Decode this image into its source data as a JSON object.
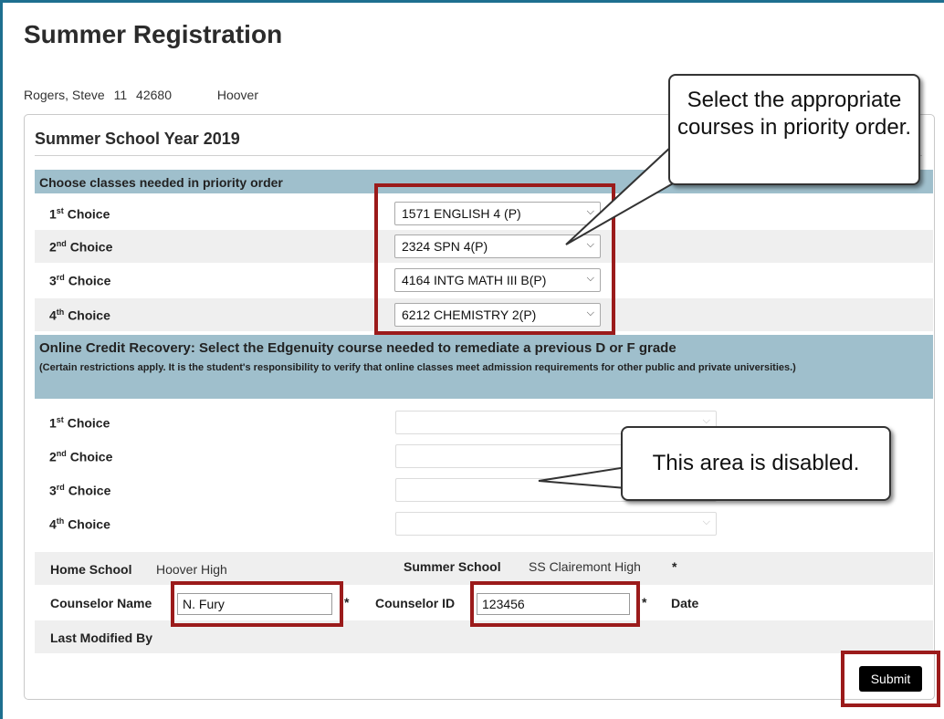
{
  "page": {
    "title": "Summer Registration"
  },
  "student": {
    "name": "Rogers, Steve",
    "grade": "11",
    "id": "42680",
    "school": "Hoover"
  },
  "panel": {
    "title": "Summer School Year 2019"
  },
  "classes": {
    "header": "Choose classes needed in priority order",
    "choices": [
      {
        "ord": "1",
        "suffix": "st",
        "label": "Choice",
        "value": "1571 ENGLISH 4 (P)"
      },
      {
        "ord": "2",
        "suffix": "nd",
        "label": "Choice",
        "value": "2324 SPN 4(P)"
      },
      {
        "ord": "3",
        "suffix": "rd",
        "label": "Choice",
        "value": "4164 INTG MATH III B(P)"
      },
      {
        "ord": "4",
        "suffix": "th",
        "label": "Choice",
        "value": "6212 CHEMISTRY 2(P)"
      }
    ]
  },
  "online": {
    "header": "Online Credit Recovery: Select the Edgenuity course needed to remediate a previous D or F grade",
    "note": "(Certain restrictions apply. It is the student's responsibility to verify that online classes meet admission requirements for other public and private universities.)",
    "choices": [
      {
        "ord": "1",
        "suffix": "st",
        "label": "Choice",
        "value": ""
      },
      {
        "ord": "2",
        "suffix": "nd",
        "label": "Choice",
        "value": ""
      },
      {
        "ord": "3",
        "suffix": "rd",
        "label": "Choice",
        "value": ""
      },
      {
        "ord": "4",
        "suffix": "th",
        "label": "Choice",
        "value": ""
      }
    ]
  },
  "footer": {
    "home_school_label": "Home School",
    "home_school_value": "Hoover High",
    "summer_school_label": "Summer School",
    "summer_school_value": "SS Clairemont High",
    "required_mark": "*",
    "counselor_name_label": "Counselor Name",
    "counselor_name_value": "N. Fury",
    "counselor_id_label": "Counselor ID",
    "counselor_id_value": "123456",
    "date_label": "Date",
    "last_modified_label": "Last Modified By"
  },
  "submit_label": "Submit",
  "callouts": {
    "select_courses": "Select the appropriate courses in priority order.",
    "disabled": "This area is disabled."
  },
  "colors": {
    "frame": "#1e6f8f",
    "section_header": "#9fbfcc",
    "highlight": "#9b1b1b",
    "submit_bg": "#000000"
  }
}
